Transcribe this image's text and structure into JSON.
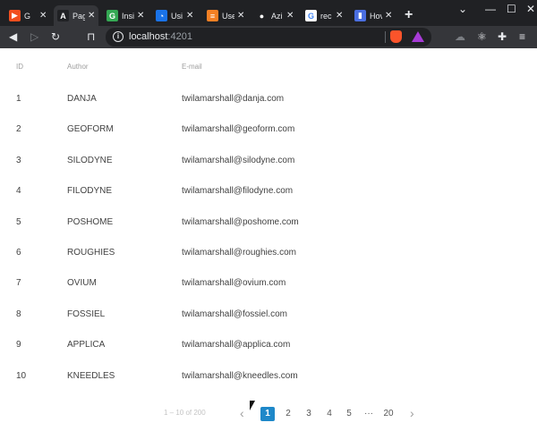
{
  "browser": {
    "tabs": [
      {
        "title": "G",
        "fav_icon": "figma-icon",
        "fav_color": "#f24e1e",
        "fav_text": "▶"
      },
      {
        "title": "Pag",
        "fav_icon": "angular-icon",
        "fav_color": "#202124",
        "fav_text": "A",
        "active": true
      },
      {
        "title": "Insi",
        "fav_icon": "green-g-icon",
        "fav_color": "#34a853",
        "fav_text": "G"
      },
      {
        "title": "Usi",
        "fav_icon": "blue-circle-icon",
        "fav_color": "#1a73e8",
        "fav_text": "◔"
      },
      {
        "title": "Use",
        "fav_icon": "stackoverflow-icon",
        "fav_color": "#f48024",
        "fav_text": "≡"
      },
      {
        "title": "Azi",
        "fav_icon": "github-icon",
        "fav_color": "#202124",
        "fav_text": "●"
      },
      {
        "title": "rec",
        "fav_icon": "google-icon",
        "fav_color": "#ffffff",
        "fav_text": "G"
      },
      {
        "title": "Hov",
        "fav_icon": "blue-square-icon",
        "fav_color": "#4a6ee0",
        "fav_text": "▮"
      }
    ],
    "url_host": "localhost",
    "url_port": ":4201"
  },
  "table": {
    "headers": {
      "id": "ID",
      "author": "Author",
      "email": "E-mail"
    },
    "rows": [
      {
        "id": "1",
        "author": "DANJA",
        "email": "twilamarshall@danja.com"
      },
      {
        "id": "2",
        "author": "GEOFORM",
        "email": "twilamarshall@geoform.com"
      },
      {
        "id": "3",
        "author": "SILODYNE",
        "email": "twilamarshall@silodyne.com"
      },
      {
        "id": "4",
        "author": "FILODYNE",
        "email": "twilamarshall@filodyne.com"
      },
      {
        "id": "5",
        "author": "POSHOME",
        "email": "twilamarshall@poshome.com"
      },
      {
        "id": "6",
        "author": "ROUGHIES",
        "email": "twilamarshall@roughies.com"
      },
      {
        "id": "7",
        "author": "OVIUM",
        "email": "twilamarshall@ovium.com"
      },
      {
        "id": "8",
        "author": "FOSSIEL",
        "email": "twilamarshall@fossiel.com"
      },
      {
        "id": "9",
        "author": "APPLICA",
        "email": "twilamarshall@applica.com"
      },
      {
        "id": "10",
        "author": "KNEEDLES",
        "email": "twilamarshall@kneedles.com"
      }
    ]
  },
  "pagination": {
    "range": "1 – 10 of 200",
    "pages": [
      "1",
      "2",
      "3",
      "4",
      "5"
    ],
    "ellipsis": "···",
    "last": "20",
    "current": "1",
    "prev": "‹",
    "next": "›"
  },
  "colors": {
    "accent": "#1e88c9"
  }
}
